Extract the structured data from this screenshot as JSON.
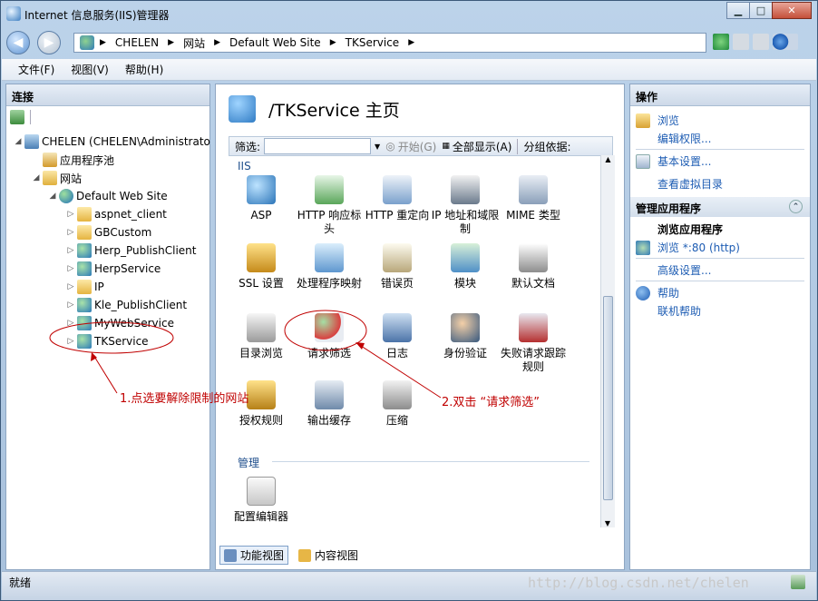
{
  "window": {
    "title": "Internet 信息服务(IIS)管理器"
  },
  "address": {
    "crumbs": [
      "CHELEN",
      "网站",
      "Default Web Site",
      "TKService"
    ]
  },
  "menu": {
    "items": [
      "文件(F)",
      "视图(V)",
      "帮助(H)"
    ]
  },
  "connections": {
    "title": "连接",
    "tree": [
      {
        "label": "CHELEN (CHELEN\\Administrato",
        "expander": "◢"
      },
      {
        "label": "应用程序池",
        "expander": ""
      },
      {
        "label": "网站",
        "expander": "◢"
      },
      {
        "label": "Default Web Site",
        "expander": "◢"
      },
      {
        "label": "aspnet_client",
        "expander": "▷"
      },
      {
        "label": "GBCustom",
        "expander": "▷"
      },
      {
        "label": "Herp_PublishClient",
        "expander": "▷"
      },
      {
        "label": "HerpService",
        "expander": "▷"
      },
      {
        "label": "IP",
        "expander": "▷"
      },
      {
        "label": "Kle_PublishClient",
        "expander": "▷"
      },
      {
        "label": "MyWebService",
        "expander": "▷"
      },
      {
        "label": "TKService",
        "expander": "▷"
      }
    ]
  },
  "main": {
    "title": "/TKService 主页",
    "filter": {
      "label": "筛选:",
      "go": "开始(G)",
      "show_all": "全部显示(A)",
      "group_by": "分组依据:"
    },
    "groups": [
      {
        "name": "IIS",
        "features": [
          "ASP",
          "HTTP 响应标头",
          "HTTP 重定向",
          "IP 地址和域限制",
          "MIME 类型",
          "SSL 设置",
          "处理程序映射",
          "错误页",
          "模块",
          "默认文档",
          "目录浏览",
          "请求筛选",
          "日志",
          "身份验证",
          "失败请求跟踪规则",
          "授权规则",
          "输出缓存",
          "压缩"
        ]
      },
      {
        "name": "管理",
        "features": [
          "配置编辑器"
        ]
      }
    ],
    "view_tabs": [
      "功能视图",
      "内容视图"
    ]
  },
  "actions": {
    "title": "操作",
    "browse": "浏览",
    "edit_permissions": "编辑权限...",
    "basic_settings": "基本设置...",
    "view_vdirs": "查看虚拟目录",
    "manage_app_title": "管理应用程序",
    "browse_app_title": "浏览应用程序",
    "browse_port": "浏览 *:80 (http)",
    "advanced_settings": "高级设置...",
    "help": "帮助",
    "online_help": "联机帮助"
  },
  "status": {
    "text": "就绪",
    "watermark": "http://blog.csdn.net/chelen"
  },
  "annotations": {
    "step1": "1.点选要解除限制的网站",
    "step2": "2.双击 “请求筛选”"
  },
  "colors": {
    "annotation": "#c00000",
    "link": "#1d5cb3",
    "group": "#1e4e8c"
  }
}
